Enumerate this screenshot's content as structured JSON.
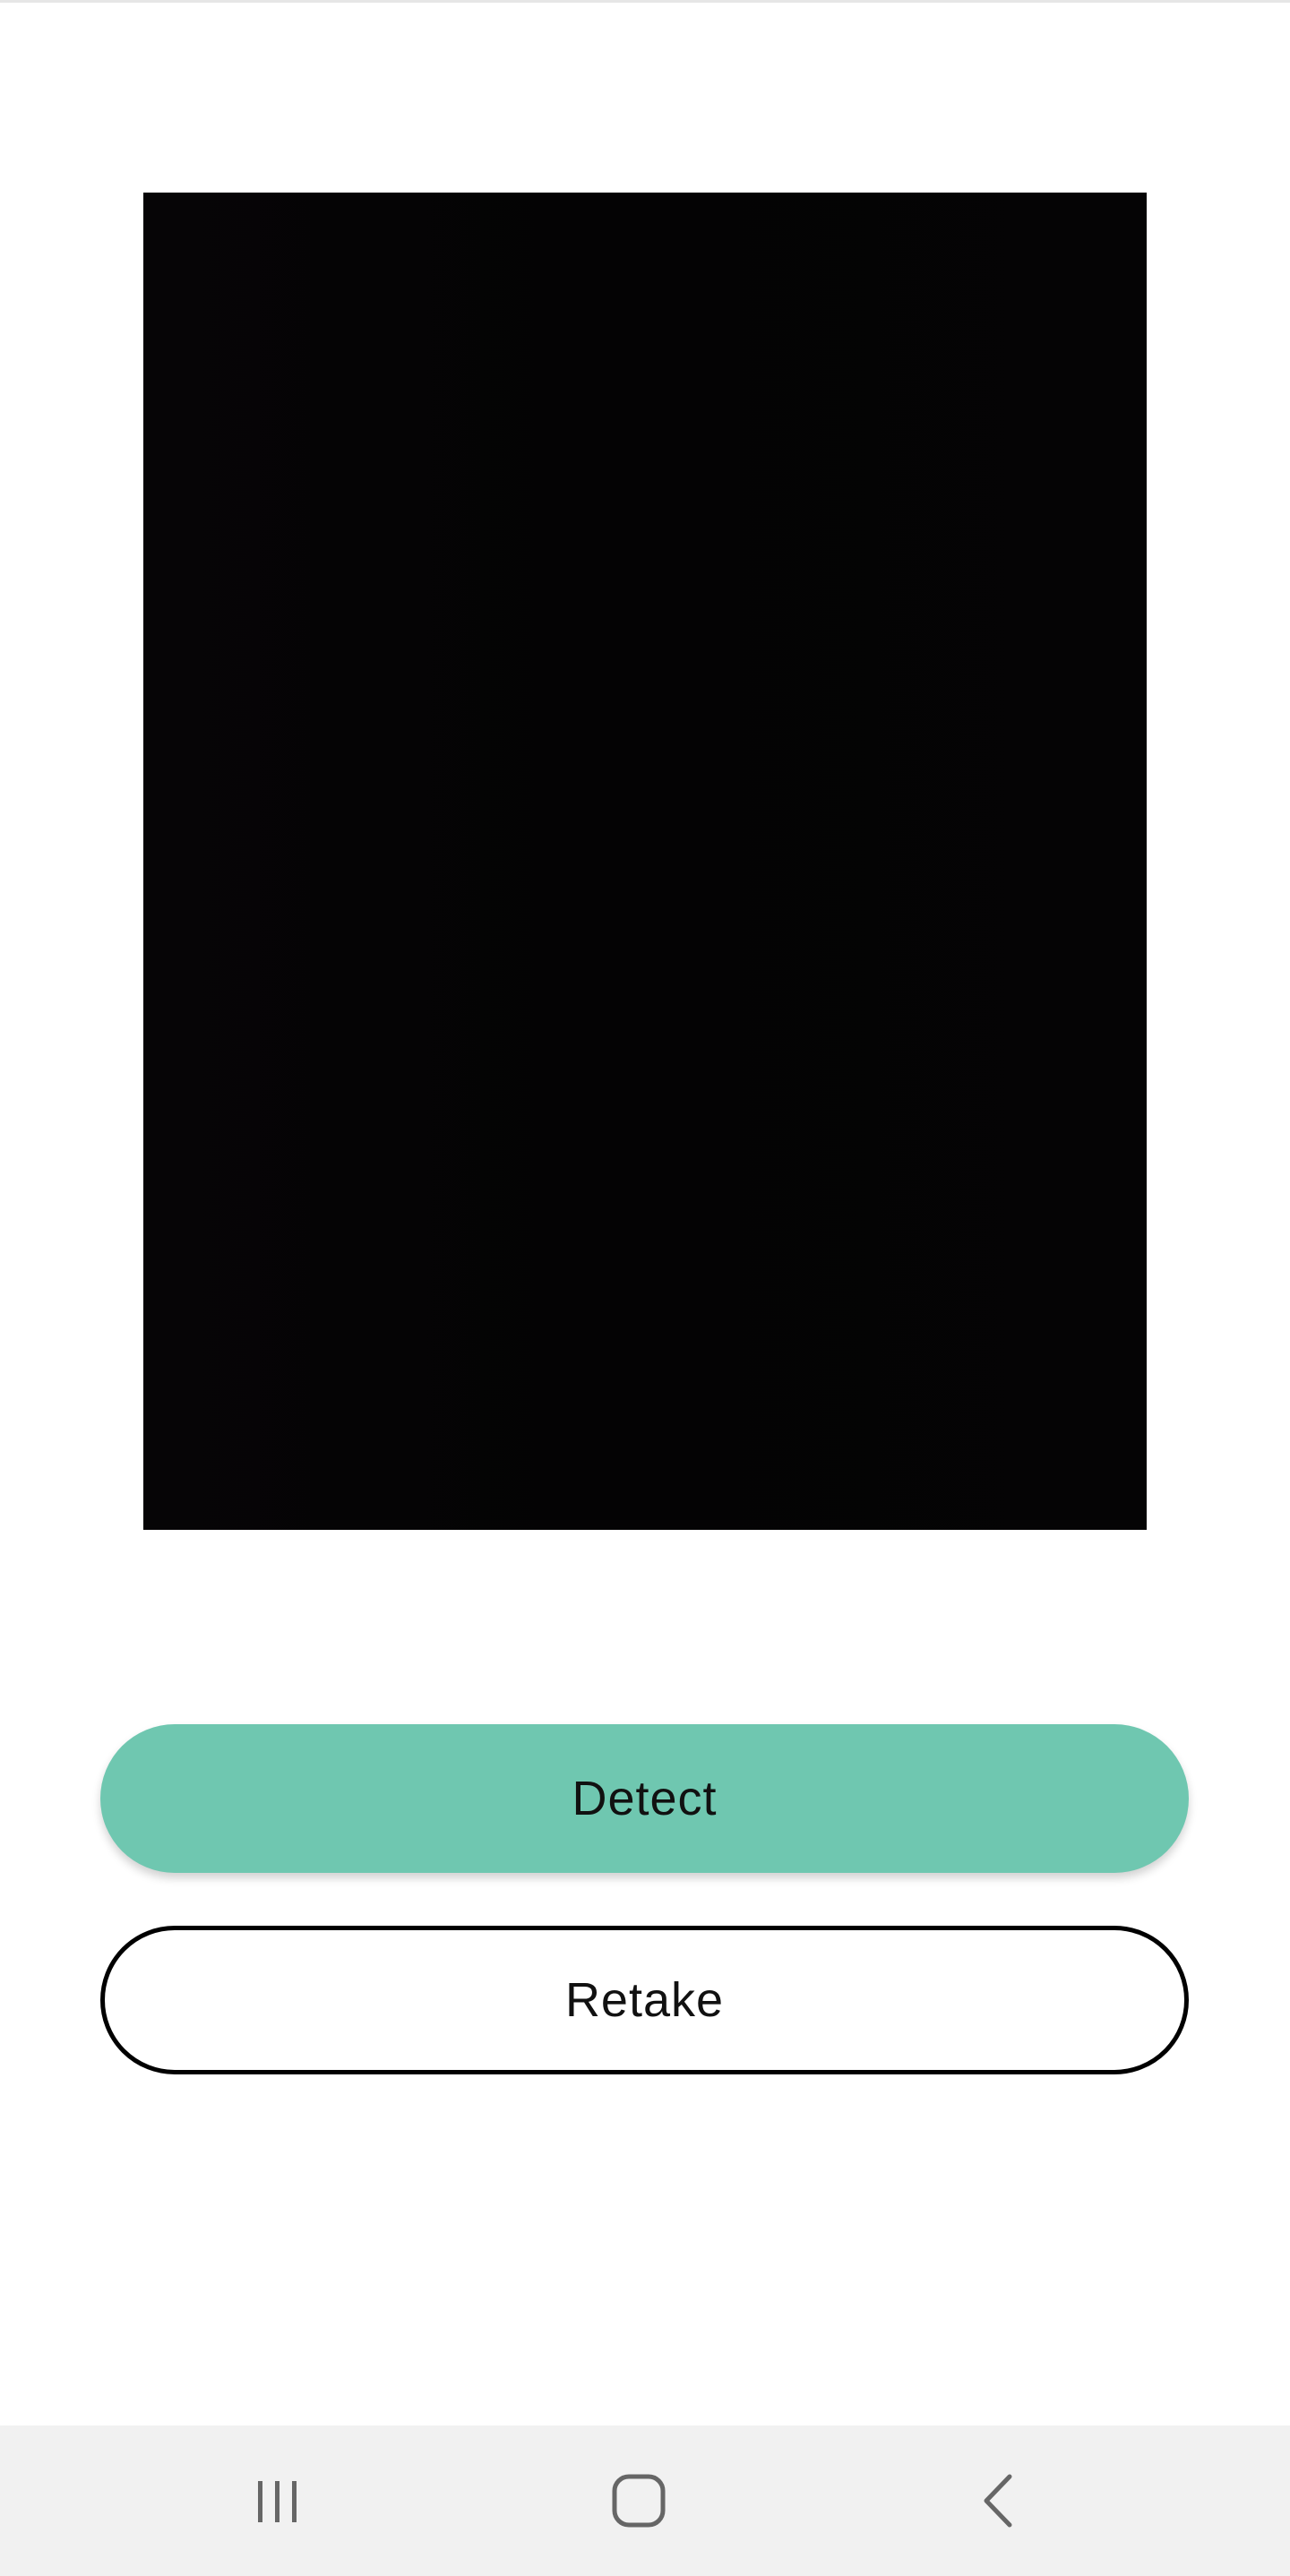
{
  "camera_preview": {
    "background": "#050405"
  },
  "actions": {
    "detect_label": "Detect",
    "retake_label": "Retake",
    "accent_color": "#6fc7b0"
  },
  "navigation_bar": {
    "icons": [
      "recents-icon",
      "home-icon",
      "back-icon"
    ]
  }
}
